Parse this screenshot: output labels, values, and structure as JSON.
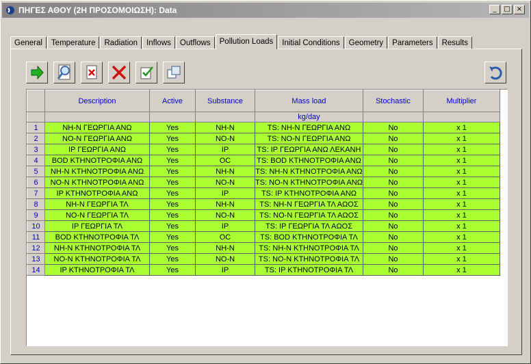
{
  "window": {
    "title": "ΠΗΓΕΣ ΑΘΟΥ (2Η ΠΡΟΣΟΜΟΙΩΣΗ): Data"
  },
  "tabs": [
    {
      "label": "General"
    },
    {
      "label": "Temperature"
    },
    {
      "label": "Radiation"
    },
    {
      "label": "Inflows"
    },
    {
      "label": "Outflows"
    },
    {
      "label": "Pollution Loads"
    },
    {
      "label": "Initial Conditions"
    },
    {
      "label": "Geometry"
    },
    {
      "label": "Parameters"
    },
    {
      "label": "Results"
    }
  ],
  "active_tab": "Pollution Loads",
  "toolbar": [
    {
      "name": "go-arrow-icon"
    },
    {
      "name": "find-icon"
    },
    {
      "name": "delete-doc-icon"
    },
    {
      "name": "delete-x-icon"
    },
    {
      "name": "checklist-icon"
    },
    {
      "name": "copy-icon"
    }
  ],
  "grid": {
    "columns": [
      "Description",
      "Active",
      "Substance",
      "Mass load",
      "Stochastic",
      "Multiplier"
    ],
    "units": [
      "",
      "",
      "",
      "kg/day",
      "",
      ""
    ],
    "rows": [
      [
        "1",
        "NH-N ΓΕΩΡΓΙΑ ΑΝΩ",
        "Yes",
        "NH-N",
        "TS: NH-N ΓΕΩΡΓΙΑ ΑΝΩ",
        "No",
        "x 1"
      ],
      [
        "2",
        "NO-N ΓΕΩΡΓΙΑ ΑΝΩ",
        "Yes",
        "NO-N",
        "TS: NO-N ΓΕΩΡΓΙΑ ΑΝΩ",
        "No",
        "x 1"
      ],
      [
        "3",
        "IP ΓΕΩΡΓΙΑ ΑΝΩ",
        "Yes",
        "IP",
        "TS: IP ΓΕΩΡΓΙΑ ΑΝΩ ΛΕΚΑΝΗ",
        "No",
        "x 1"
      ],
      [
        "4",
        "BOD ΚΤΗΝΟΤΡΟΦΙΑ ΑΝΩ",
        "Yes",
        "OC",
        "TS: BOD ΚΤΗΝΟΤΡΟΦΙΑ ΑΝΩ",
        "No",
        "x 1"
      ],
      [
        "5",
        "NH-N ΚΤΗΝΟΤΡΟΦΙΑ ΑΝΩ",
        "Yes",
        "NH-N",
        "TS: NH-N ΚΤΗΝΟΤΡΟΦΙΑ ΑΝΩ",
        "No",
        "x 1"
      ],
      [
        "6",
        "NO-N ΚΤΗΝΟΤΡΟΦΙΑ ΑΝΩ",
        "Yes",
        "NO-N",
        "TS: NO-N ΚΤΗΝΟΤΡΟΦΙΑ ΑΝΩ",
        "No",
        "x 1"
      ],
      [
        "7",
        "IP ΚΤΗΝΟΤΡΟΦΙΑ ΑΝΩ",
        "Yes",
        "IP",
        "TS: IP ΚΤΗΝΟΤΡΟΦΙΑ ΑΝΩ",
        "No",
        "x 1"
      ],
      [
        "8",
        "NH-N ΓΕΩΡΓΙΑ ΤΛ",
        "Yes",
        "NH-N",
        "TS: NH-N ΓΕΩΡΓΙΑ ΤΛ ΑΩΟΣ",
        "No",
        "x 1"
      ],
      [
        "9",
        "NO-N ΓΕΩΡΓΙΑ ΤΛ",
        "Yes",
        "NO-N",
        "TS: NO-N ΓΕΩΡΓΙΑ ΤΛ ΑΩΟΣ",
        "No",
        "x 1"
      ],
      [
        "10",
        "IP ΓΕΩΡΓΙΑ ΤΛ",
        "Yes",
        "IP",
        "TS: IP ΓΕΩΡΓΙΑ ΤΛ ΑΩΟΣ",
        "No",
        "x 1"
      ],
      [
        "11",
        "BOD ΚΤΗΝΟΤΡΟΦΙΑ ΤΛ",
        "Yes",
        "OC",
        "TS: BOD ΚΤΗΝΟΤΡΟΦΙΑ ΤΛ",
        "No",
        "x 1"
      ],
      [
        "12",
        "NH-N ΚΤΗΝΟΤΡΟΦΙΑ ΤΛ",
        "Yes",
        "NH-N",
        "TS: NH-N ΚΤΗΝΟΤΡΟΦΙΑ ΤΛ",
        "No",
        "x 1"
      ],
      [
        "13",
        "NO-N ΚΤΗΝΟΤΡΟΦΙΑ ΤΛ",
        "Yes",
        "NO-N",
        "TS: NO-N ΚΤΗΝΟΤΡΟΦΙΑ ΤΛ",
        "No",
        "x 1"
      ],
      [
        "14",
        "IP ΚΤΗΝΟΤΡΟΦΙΑ ΤΛ",
        "Yes",
        "IP",
        "TS: IP ΚΤΗΝΟΤΡΟΦΙΑ ΤΛ",
        "No",
        "x 1"
      ]
    ]
  },
  "colors": {
    "row_fill": "#aaff33",
    "header_text": "#0000c0",
    "title_bar": "#848284"
  }
}
